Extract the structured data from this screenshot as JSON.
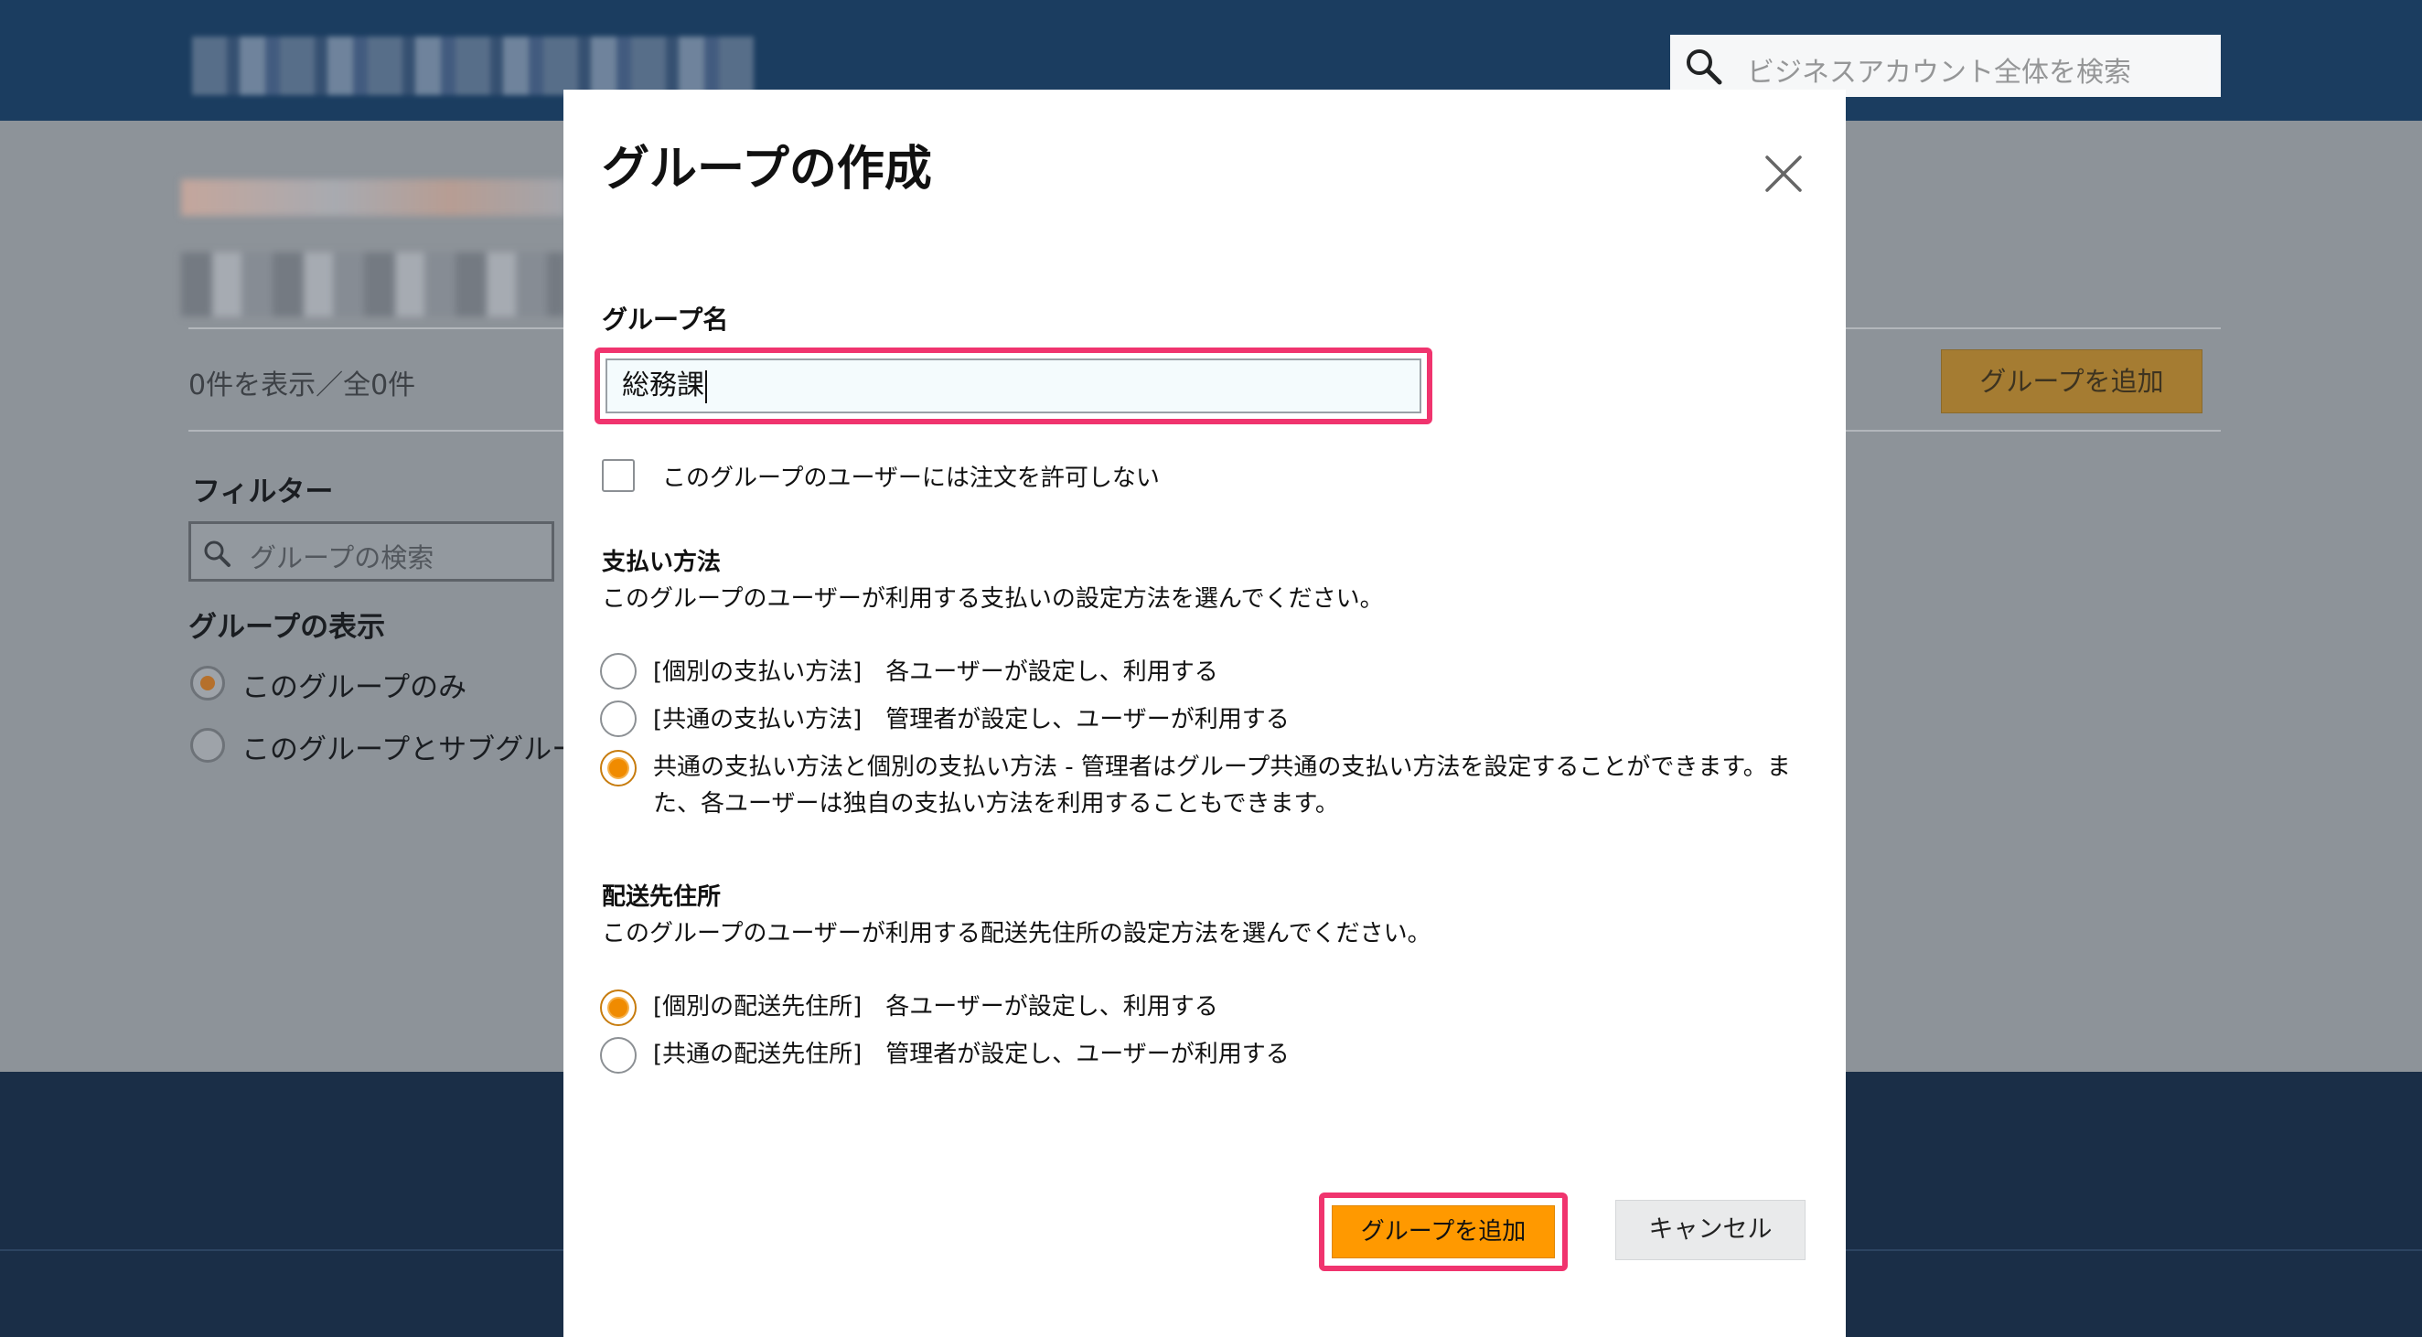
{
  "header": {
    "search_placeholder": "ビジネスアカウント全体を検索",
    "icons": {
      "search": "search-icon"
    }
  },
  "background": {
    "count_text": "0件を表示／全0件",
    "add_group_label": "グループを追加",
    "filter_title": "フィルター",
    "group_search_placeholder": "グループの検索",
    "group_display_title": "グループの表示",
    "group_display_options": [
      {
        "label": "このグループのみ",
        "selected": true
      },
      {
        "label": "このグループとサブグループ",
        "selected": false
      }
    ]
  },
  "modal": {
    "title": "グループの作成",
    "close_icon": "close-icon",
    "group_name_label": "グループ名",
    "group_name_value": "総務課",
    "disallow_orders_label": "このグループのユーザーには注文を許可しない",
    "disallow_orders_checked": false,
    "payment": {
      "title": "支払い方法",
      "description": "このグループのユーザーが利用する支払いの設定方法を選んでください。",
      "options": [
        {
          "label": "[個別の支払い方法]　各ユーザーが設定し、利用する",
          "selected": false
        },
        {
          "label": "[共通の支払い方法]　管理者が設定し、ユーザーが利用する",
          "selected": false
        },
        {
          "label_line1": "共通の支払い方法と個別の支払い方法 - 管理者はグループ共通の支払い方法を設定することができます。ま",
          "label_line2": "た、各ユーザーは独自の支払い方法を利用することもできます。",
          "selected": true
        }
      ]
    },
    "shipping": {
      "title": "配送先住所",
      "description": "このグループのユーザーが利用する配送先住所の設定方法を選んでください。",
      "options": [
        {
          "label": "[個別の配送先住所]　各ユーザーが設定し、利用する",
          "selected": true
        },
        {
          "label": "[共通の配送先住所]　管理者が設定し、ユーザーが利用する",
          "selected": false
        }
      ]
    },
    "add_button_label": "グループを追加",
    "cancel_button_label": "キャンセル"
  },
  "colors": {
    "header_bg": "#1b3d60",
    "primary_button": "#ff9900",
    "highlight": "#f0346e",
    "radio_selected": "#f08b00"
  }
}
